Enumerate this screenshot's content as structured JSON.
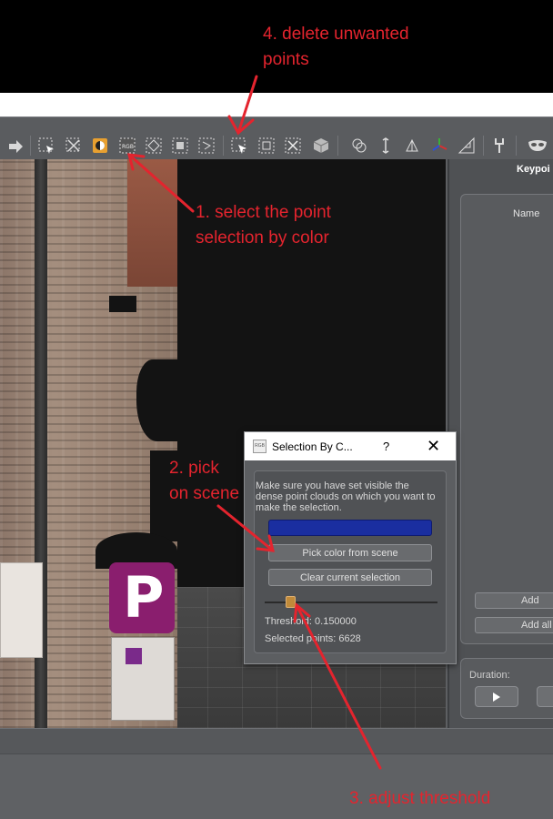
{
  "annotations": {
    "step1_line1": "1. select the point",
    "step1_line2": "selection by color",
    "step2_line1": "2. pick",
    "step2_line2": "on scene",
    "step3": "3. adjust threshold",
    "step4_line1": "4. delete unwanted",
    "step4_line2": "points",
    "color": "#e4242e"
  },
  "toolbar": {
    "icons": [
      "redo-icon",
      "select-rect-icon",
      "select-invert-icon",
      "color-circle-icon",
      "select-by-color-icon",
      "select-all-icon",
      "select-dots-icon",
      "select-lasso-icon",
      "delete-points-icon",
      "crop-icon",
      "scissors-icon",
      "cube-icon",
      "knot-icon",
      "measure-icon",
      "transform-icon",
      "axis-icon",
      "ruler-icon",
      "tool-icon",
      "mask-icon"
    ]
  },
  "right_panel": {
    "title": "Keypoi",
    "column_name": "Name",
    "add_button": "Add",
    "add_all_button": "Add all",
    "duration_label": "Duration:"
  },
  "dialog": {
    "title": "Selection By C...",
    "help": "?",
    "close": "✕",
    "icon_text": "RGB",
    "hint": "Make sure you have set visible the dense point clouds on which you want to make the selection.",
    "selected_color": "#1a2ea0",
    "pick_button": "Pick color from scene",
    "clear_button": "Clear current selection",
    "threshold_text": "Threshold: 0.150000",
    "selected_points_text": "Selected points: 6628",
    "threshold_value": 0.15,
    "threshold_slider_fraction": 0.15
  },
  "viewport": {
    "parking_letter": "P"
  }
}
